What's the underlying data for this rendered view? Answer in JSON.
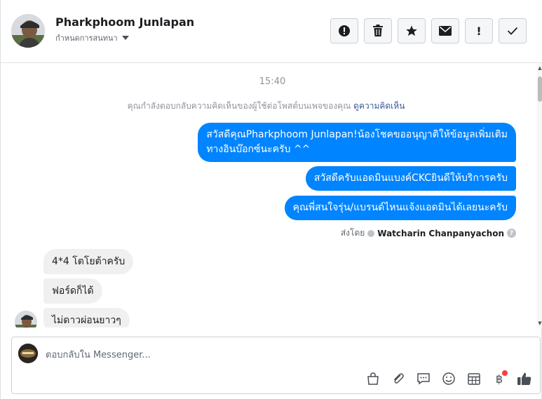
{
  "header": {
    "name": "Pharkphoom Junlapan",
    "assign_label": "กำหนดการสนทนา",
    "actions": [
      {
        "icon": "alert-circle-icon",
        "glyph": "!"
      },
      {
        "icon": "trash-icon"
      },
      {
        "icon": "star-icon"
      },
      {
        "icon": "envelope-icon"
      },
      {
        "icon": "exclamation-icon",
        "glyph": "!"
      },
      {
        "icon": "check-icon"
      }
    ]
  },
  "conversation": {
    "timestamp": "15:40",
    "info_text": "คุณกำลังตอบกลับความคิดเห็นของผู้ใช้ต่อโพสต์บนเพจของคุณ",
    "info_link": "ดูความคิดเห็น",
    "outgoing": [
      {
        "line1": "สวัสดีคุณPharkphoom Junlapan!น้องโชคขออนุญาติให้ข้อมูลเพิ่มเติม",
        "line2": "ทางอินบ๊อกซ์นะครับ ^^"
      },
      {
        "text": "สวัสดีครับแอดมินแบงค์CKCยินดีให้บริการครับ"
      },
      {
        "text": "คุณพี่สนใจรุ่น/แบรนด์ไหนแจ้งแอดมินได้เลยนะครับ"
      }
    ],
    "sent_by_label": "ส่งโดย",
    "sent_by_name": "Watcharin Chanpanyachon",
    "help_glyph": "?",
    "incoming": [
      {
        "text": "4*4 โตโยต้าครับ"
      },
      {
        "text": "ฟอร์ดก็ได้"
      },
      {
        "text": "ไม่ดาวผ่อนยาวๆ"
      }
    ]
  },
  "composer": {
    "placeholder": "ตอบกลับใน Messenger...",
    "tools": [
      "bag-icon",
      "paperclip-icon",
      "chat-bubble-icon",
      "smiley-icon",
      "calendar-icon",
      "baht-icon",
      "thumbs-up-icon"
    ],
    "baht_glyph": "฿"
  },
  "colors": {
    "outgoing_bubble": "#0084ff",
    "incoming_bubble": "#f1f0f0",
    "link": "#385898",
    "notification_dot": "#fa3e3e"
  }
}
